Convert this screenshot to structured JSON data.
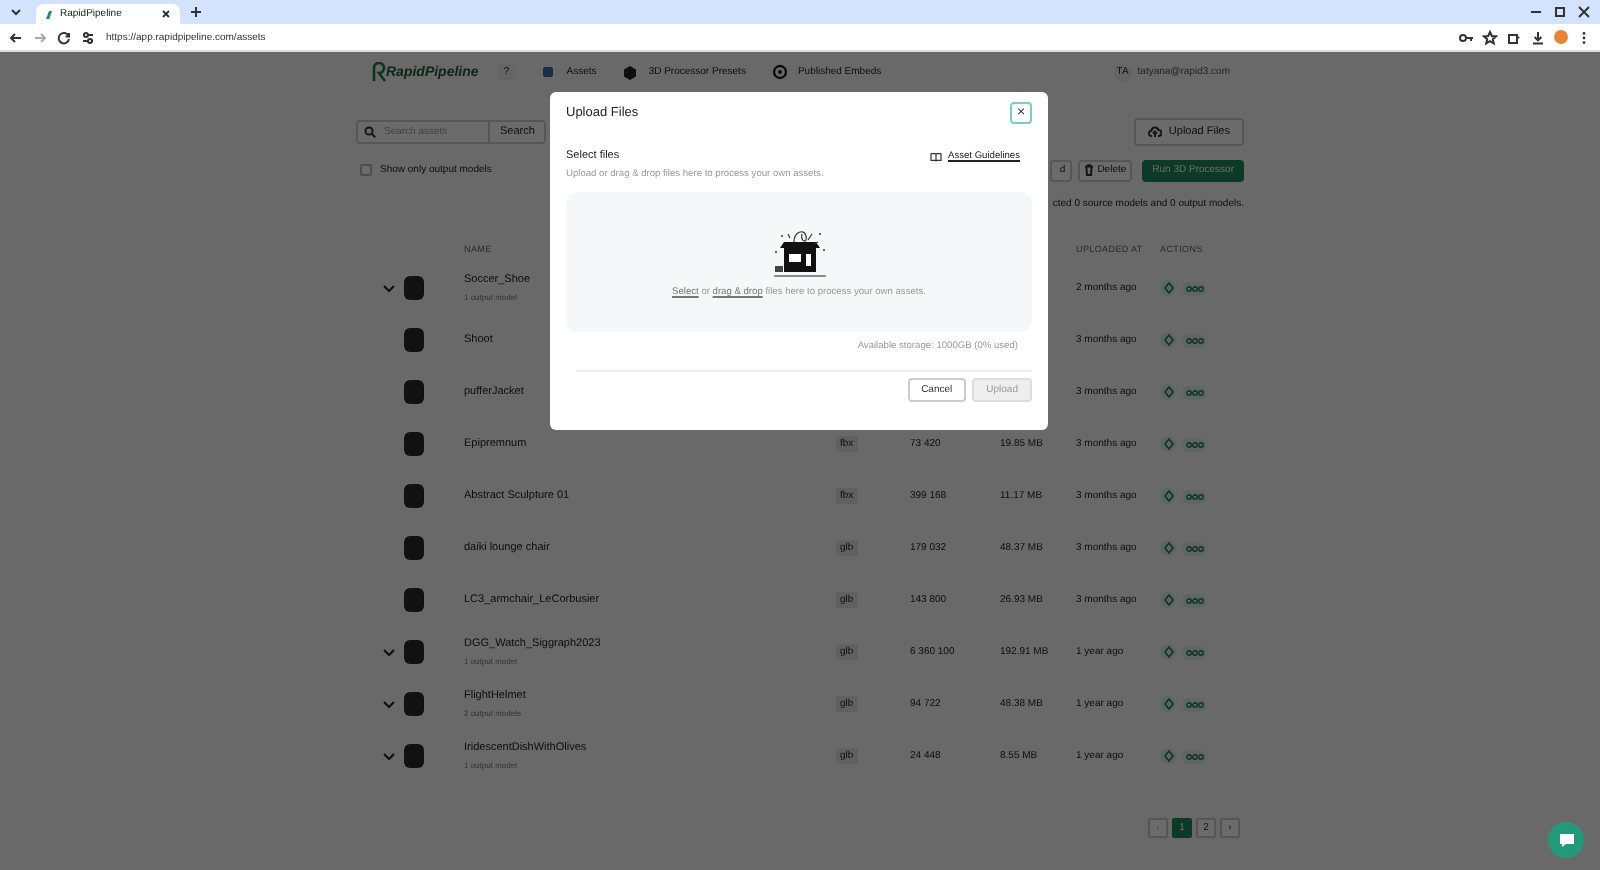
{
  "browser": {
    "tab_title": "RapidPipeline",
    "url": "https://app.rapidpipeline.com/assets"
  },
  "header": {
    "logo": "RapidPipeline",
    "help": "?",
    "nav": [
      {
        "label": "Assets",
        "kind": "assets"
      },
      {
        "label": "3D Processor Presets",
        "kind": "presets"
      },
      {
        "label": "Published Embeds",
        "kind": "embeds"
      }
    ],
    "user": {
      "initials": "TA",
      "email": "tatyana@rapid3.com"
    }
  },
  "toolbar": {
    "search": {
      "placeholder": "Search assets",
      "button": "Search"
    },
    "upload_button": "Upload Files",
    "filter": {
      "label": "Show only output models",
      "checked": false
    },
    "actions": [
      {
        "label": "d",
        "kind": "plain"
      },
      {
        "label": "Delete",
        "kind": "delete"
      },
      {
        "label": "Run 3D Processor",
        "kind": "primary"
      }
    ],
    "selection_note": "cted 0 source models and 0 output models."
  },
  "table": {
    "columns": [
      {
        "label": "NAME",
        "kind": "name"
      },
      {
        "label": "UPLOADED AT",
        "kind": "uploaded"
      },
      {
        "label": "ACTIONS",
        "kind": "actions"
      }
    ],
    "rows": [
      {
        "name": "Soccer_Shoe",
        "subtitle": "1 output model",
        "uploaded": "2 months ago"
      },
      {
        "name": "Shoot",
        "uploaded": "3 months ago"
      },
      {
        "name": "pufferJacket",
        "uploaded": "3 months ago"
      },
      {
        "name": "Epipremnum",
        "format": "fbx",
        "polygons": "73 420",
        "size": "19.85 MB",
        "uploaded": "3 months ago"
      },
      {
        "name": "Abstract Sculpture 01",
        "format": "fbx",
        "polygons": "399 168",
        "size": "11.17 MB",
        "uploaded": "3 months ago"
      },
      {
        "name": "daiki lounge chair",
        "format": "glb",
        "polygons": "179 032",
        "size": "48.37 MB",
        "uploaded": "3 months ago"
      },
      {
        "name": "LC3_armchair_LeCorbusier",
        "format": "glb",
        "polygons": "143 800",
        "size": "26.93 MB",
        "uploaded": "3 months ago"
      },
      {
        "name": "DGG_Watch_Siggraph2023",
        "subtitle": "1 output model",
        "format": "glb",
        "polygons": "6 360 100",
        "size": "192.91 MB",
        "uploaded": "1 year ago"
      },
      {
        "name": "FlightHelmet",
        "subtitle": "2 output models",
        "format": "glb",
        "polygons": "94 722",
        "size": "48.38 MB",
        "uploaded": "1 year ago"
      },
      {
        "name": "IridescentDishWithOlives",
        "subtitle": "1 output model",
        "format": "glb",
        "polygons": "24 448",
        "size": "8.55 MB",
        "uploaded": "1 year ago"
      }
    ]
  },
  "pagination": {
    "prev": "‹",
    "next": "›",
    "pages": [
      {
        "label": "1",
        "selected": true
      },
      {
        "label": "2",
        "selected": false
      }
    ]
  },
  "modal": {
    "title": "Upload Files",
    "close": "×",
    "section_title": "Select files",
    "guidelines_link": "Asset Guidelines",
    "hint": "Upload or drag & drop files here to process your own assets.",
    "dropzone_text": [
      {
        "text": "Select",
        "kind": "link"
      },
      {
        "text": " or ",
        "kind": "text"
      },
      {
        "text": "drag & drop",
        "kind": "link"
      },
      {
        "text": " files here to process your own assets.",
        "kind": "text"
      }
    ],
    "storage": "Available storage: 1000GB (0% used)",
    "buttons": [
      {
        "label": "Cancel",
        "disabled": false
      },
      {
        "label": "Upload",
        "disabled": true
      }
    ]
  }
}
